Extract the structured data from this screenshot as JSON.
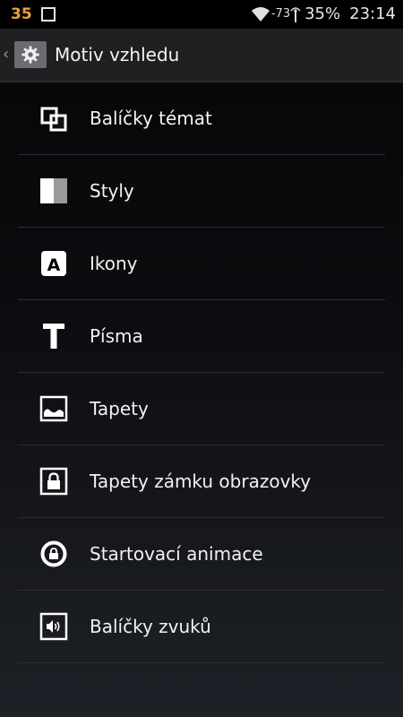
{
  "status_bar": {
    "notification_count": "35",
    "signal_strength": "-73",
    "battery": "35%",
    "time": "23:14"
  },
  "action_bar": {
    "title": "Motiv vzhledu"
  },
  "menu": {
    "items": [
      {
        "label": "Balíčky témat",
        "icon": "theme-packs-icon"
      },
      {
        "label": "Styly",
        "icon": "styles-icon"
      },
      {
        "label": "Ikony",
        "icon": "icons-icon"
      },
      {
        "label": "Písma",
        "icon": "fonts-icon"
      },
      {
        "label": "Tapety",
        "icon": "wallpaper-icon"
      },
      {
        "label": "Tapety zámku obrazovky",
        "icon": "lockscreen-wallpaper-icon"
      },
      {
        "label": "Startovací animace",
        "icon": "boot-animation-icon"
      },
      {
        "label": "Balíčky zvuků",
        "icon": "sound-packs-icon"
      }
    ]
  }
}
